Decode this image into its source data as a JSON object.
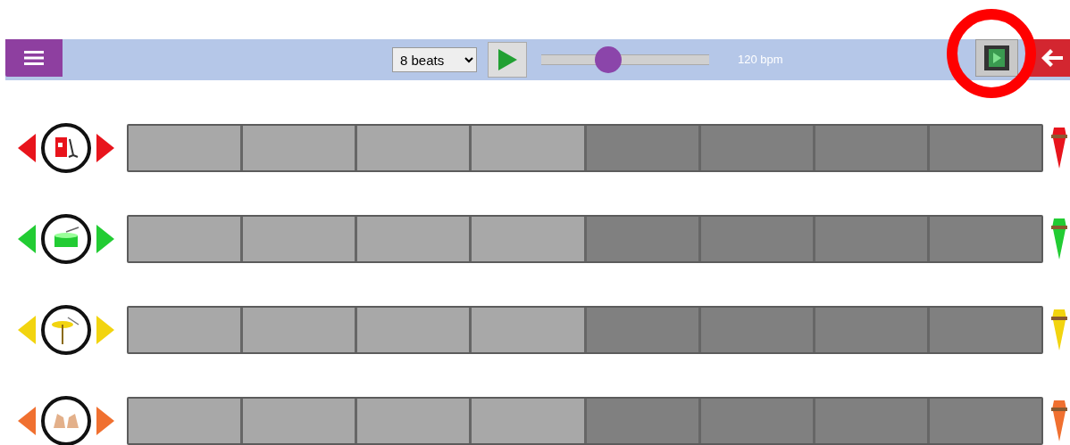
{
  "toolbar": {
    "beats_select": "8 beats",
    "tempo": {
      "level": 0.4,
      "reading": "120 bpm"
    }
  },
  "tracks": [
    {
      "kind": "kick",
      "color": "#e8141c",
      "cells": [
        {
          "highlighted": true
        },
        {
          "highlighted": true
        },
        {
          "highlighted": true
        },
        {
          "highlighted": true
        },
        {
          "highlighted": false
        },
        {
          "highlighted": false
        },
        {
          "highlighted": false
        },
        {
          "highlighted": false
        }
      ]
    },
    {
      "kind": "snare",
      "color": "#22cc33",
      "cells": [
        {
          "highlighted": true
        },
        {
          "highlighted": true
        },
        {
          "highlighted": true
        },
        {
          "highlighted": true
        },
        {
          "highlighted": false
        },
        {
          "highlighted": false
        },
        {
          "highlighted": false
        },
        {
          "highlighted": false
        }
      ]
    },
    {
      "kind": "cymbal",
      "color": "#f2d40f",
      "cells": [
        {
          "highlighted": true
        },
        {
          "highlighted": true
        },
        {
          "highlighted": true
        },
        {
          "highlighted": true
        },
        {
          "highlighted": false
        },
        {
          "highlighted": false
        },
        {
          "highlighted": false
        },
        {
          "highlighted": false
        }
      ]
    },
    {
      "kind": "hands",
      "color": "#f07030",
      "cells": [
        {
          "highlighted": true
        },
        {
          "highlighted": true
        },
        {
          "highlighted": true
        },
        {
          "highlighted": true
        },
        {
          "highlighted": false
        },
        {
          "highlighted": false
        },
        {
          "highlighted": false
        },
        {
          "highlighted": false
        }
      ]
    }
  ]
}
